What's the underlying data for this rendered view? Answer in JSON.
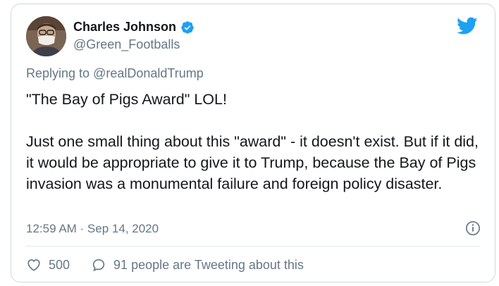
{
  "author": {
    "name": "Charles Johnson",
    "handle": "@Green_Footballs"
  },
  "reply": {
    "prefix": "Replying to ",
    "mention": "@realDonaldTrump"
  },
  "tweet": {
    "text": "\"The Bay of Pigs Award\" LOL!\n\nJust one small thing about this \"award\" - it doesn't exist. But if it did, it would be appropriate to give it to Trump, because the Bay of Pigs invasion was a monumental failure and foreign policy disaster.",
    "timestamp": "12:59 AM · Sep 14, 2020"
  },
  "stats": {
    "likes": "500",
    "conversation": "91 people are Tweeting about this"
  },
  "colors": {
    "brand_blue": "#1da1f2",
    "muted": "#657786",
    "border": "#cfd9de"
  },
  "icons": [
    "avatar",
    "verified-badge-icon",
    "twitter-bird-icon",
    "info-icon",
    "heart-icon",
    "speech-bubble-icon"
  ]
}
